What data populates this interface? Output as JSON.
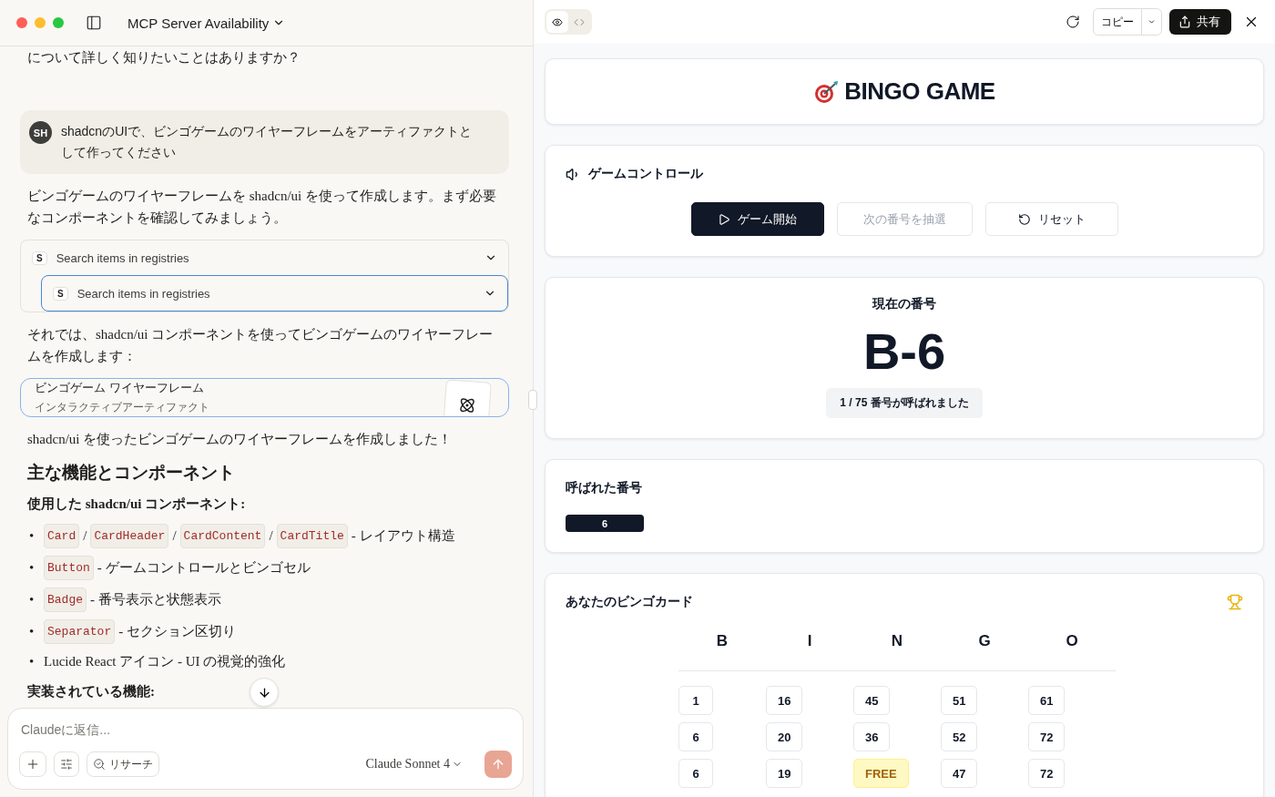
{
  "window": {
    "title": "MCP Server Availability"
  },
  "chat": [
    {
      "kind": "text",
      "text": "について詳しく知りたいことはありますか？"
    },
    {
      "kind": "user",
      "initials": "SH",
      "text": "shadcnのUIで、ビンゴゲームのワイヤーフレームをアーティファクトとして作ってください"
    },
    {
      "kind": "text",
      "text": "ビンゴゲームのワイヤーフレームを shadcn/ui を使って作成します。まず必要なコンポーネントを確認してみましょう。"
    },
    {
      "kind": "tools",
      "items": [
        {
          "badge": "S",
          "label": "Search items in registries",
          "selected": false
        },
        {
          "badge": "S",
          "label": "Search items in registries",
          "selected": true
        }
      ]
    },
    {
      "kind": "text",
      "text": "それでは、shadcn/ui コンポーネントを使ってビンゴゲームのワイヤーフレームを作成します："
    },
    {
      "kind": "artifact",
      "title": "ビンゴゲーム ワイヤーフレーム",
      "subtitle": "インタラクティブアーティファクト"
    },
    {
      "kind": "text",
      "text": "shadcn/ui を使ったビンゴゲームのワイヤーフレームを作成しました！"
    },
    {
      "kind": "heading",
      "text": "主な機能とコンポーネント"
    },
    {
      "kind": "subheading",
      "text": "使用した shadcn/ui コンポーネント:"
    },
    {
      "kind": "bullets",
      "items": [
        {
          "marker": "•",
          "segments": [
            {
              "kind": "code",
              "text": "Card"
            },
            {
              "kind": "plain",
              "text": "/"
            },
            {
              "kind": "code",
              "text": "CardHeader"
            },
            {
              "kind": "plain",
              "text": "/"
            },
            {
              "kind": "code",
              "text": "CardContent"
            },
            {
              "kind": "plain",
              "text": "/"
            },
            {
              "kind": "code",
              "text": "CardTitle"
            },
            {
              "kind": "plain",
              "text": "- レイアウト構造"
            }
          ]
        },
        {
          "marker": "•",
          "segments": [
            {
              "kind": "code",
              "text": "Button"
            },
            {
              "kind": "plain",
              "text": "- ゲームコントロールとビンゴセル"
            }
          ]
        },
        {
          "marker": "•",
          "segments": [
            {
              "kind": "code",
              "text": "Badge"
            },
            {
              "kind": "plain",
              "text": "- 番号表示と状態表示"
            }
          ]
        },
        {
          "marker": "•",
          "segments": [
            {
              "kind": "code",
              "text": "Separator"
            },
            {
              "kind": "plain",
              "text": "- セクション区切り"
            }
          ]
        },
        {
          "marker": "•",
          "segments": [
            {
              "kind": "plain",
              "text": "Lucide React アイコン - UI の視覚的強化"
            }
          ]
        }
      ]
    },
    {
      "kind": "subheading",
      "text": "実装されている機能:"
    }
  ],
  "composer": {
    "placeholder": "Claudeに返信...",
    "research": "リサーチ",
    "model": "Claude Sonnet 4"
  },
  "toolbar": {
    "views": [
      {
        "kind": "preview",
        "selected": true
      },
      {
        "kind": "code",
        "selected": false
      }
    ],
    "copy": "コピー",
    "share": "共有"
  },
  "app": {
    "title": "BINGO GAME",
    "controls": {
      "title": "ゲームコントロール",
      "buttons": [
        {
          "kind": "primary",
          "label": "ゲーム開始",
          "disabled": false
        },
        {
          "kind": "plain",
          "label": "次の番号を抽選",
          "disabled": true
        },
        {
          "kind": "reset",
          "label": "リセット",
          "disabled": false
        }
      ]
    },
    "current": {
      "label": "現在の番号",
      "value": "B-6",
      "status": "1 / 75 番号が呼ばれました"
    },
    "called": {
      "title": "呼ばれた番号",
      "numbers": [
        "6"
      ]
    },
    "card": {
      "title": "あなたのビンゴカード",
      "columns": [
        "B",
        "I",
        "N",
        "G",
        "O"
      ],
      "rows": [
        [
          {
            "kind": "number",
            "text": "1"
          },
          {
            "kind": "number",
            "text": "16"
          },
          {
            "kind": "number",
            "text": "45"
          },
          {
            "kind": "number",
            "text": "51"
          },
          {
            "kind": "number",
            "text": "61"
          }
        ],
        [
          {
            "kind": "number",
            "text": "6"
          },
          {
            "kind": "number",
            "text": "20"
          },
          {
            "kind": "number",
            "text": "36"
          },
          {
            "kind": "number",
            "text": "52"
          },
          {
            "kind": "number",
            "text": "72"
          }
        ],
        [
          {
            "kind": "number",
            "text": "6"
          },
          {
            "kind": "number",
            "text": "19"
          },
          {
            "kind": "free",
            "text": "FREE"
          },
          {
            "kind": "number",
            "text": "47"
          },
          {
            "kind": "number",
            "text": "72"
          }
        ]
      ]
    }
  }
}
